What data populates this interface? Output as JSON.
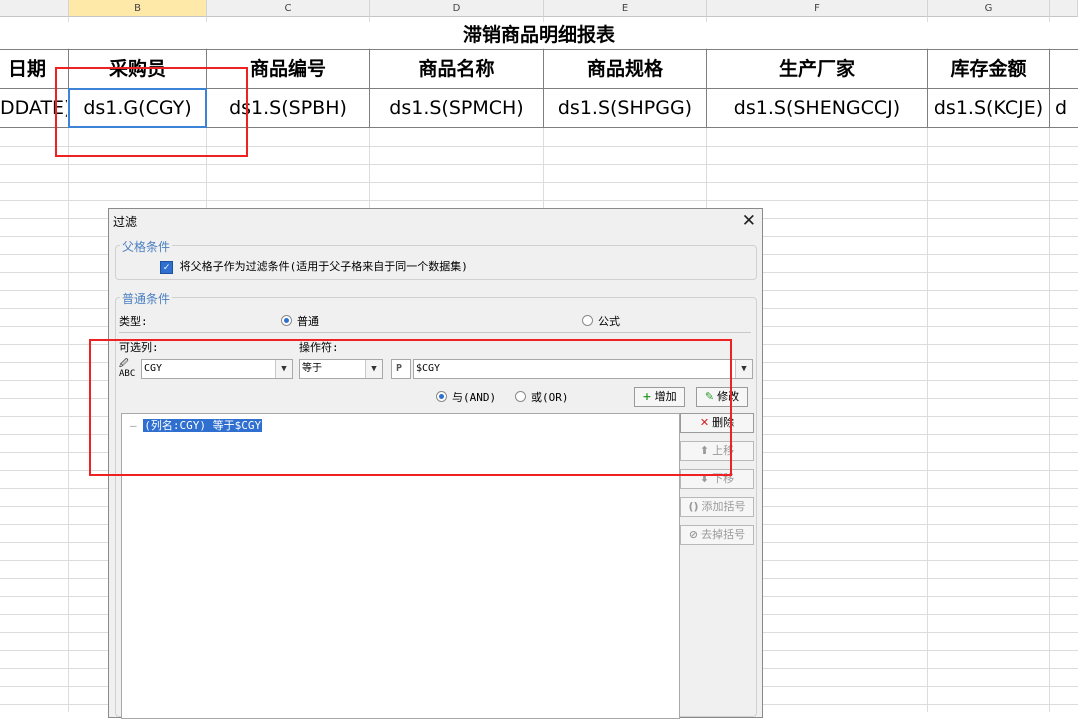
{
  "columns": [
    "B",
    "C",
    "D",
    "E",
    "F",
    "G"
  ],
  "sheet": {
    "title": "滞销商品明细报表",
    "headers": [
      "日期",
      "采购员",
      "商品编号",
      "商品名称",
      "商品规格",
      "生产厂家",
      "库存金额"
    ],
    "cells": [
      "DDATE)",
      "ds1.G(CGY)",
      "ds1.S(SPBH)",
      "ds1.S(SPMCH)",
      "ds1.S(SHPGG)",
      "ds1.S(SHENGCCJ)",
      "ds1.S(KCJE)",
      "d"
    ]
  },
  "dialog": {
    "title": "过滤",
    "parent_group": {
      "label": "父格条件",
      "checkbox_label": "将父格子作为过滤条件(适用于父子格来自于同一个数据集)",
      "checked": true
    },
    "normal_group": {
      "label": "普通条件",
      "type_label": "类型:",
      "type_options": [
        "普通",
        "公式"
      ],
      "type_selected": "普通",
      "column_label": "可选列:",
      "column_value": "CGY",
      "operator_label": "操作符:",
      "operator_value": "等于",
      "param_icon": "P",
      "value": "$CGY",
      "logic_options": [
        "与(AND)",
        "或(OR)"
      ],
      "logic_selected": "与(AND)",
      "add_button": "增加",
      "modify_button": "修改"
    },
    "conditions": [
      {
        "text": "(列名:CGY) 等于$CGY",
        "selected": true
      }
    ],
    "side_buttons": {
      "delete": "删除",
      "up": "上移",
      "down": "下移",
      "add_bracket": "添加括号",
      "remove_bracket": "去掉括号"
    }
  }
}
